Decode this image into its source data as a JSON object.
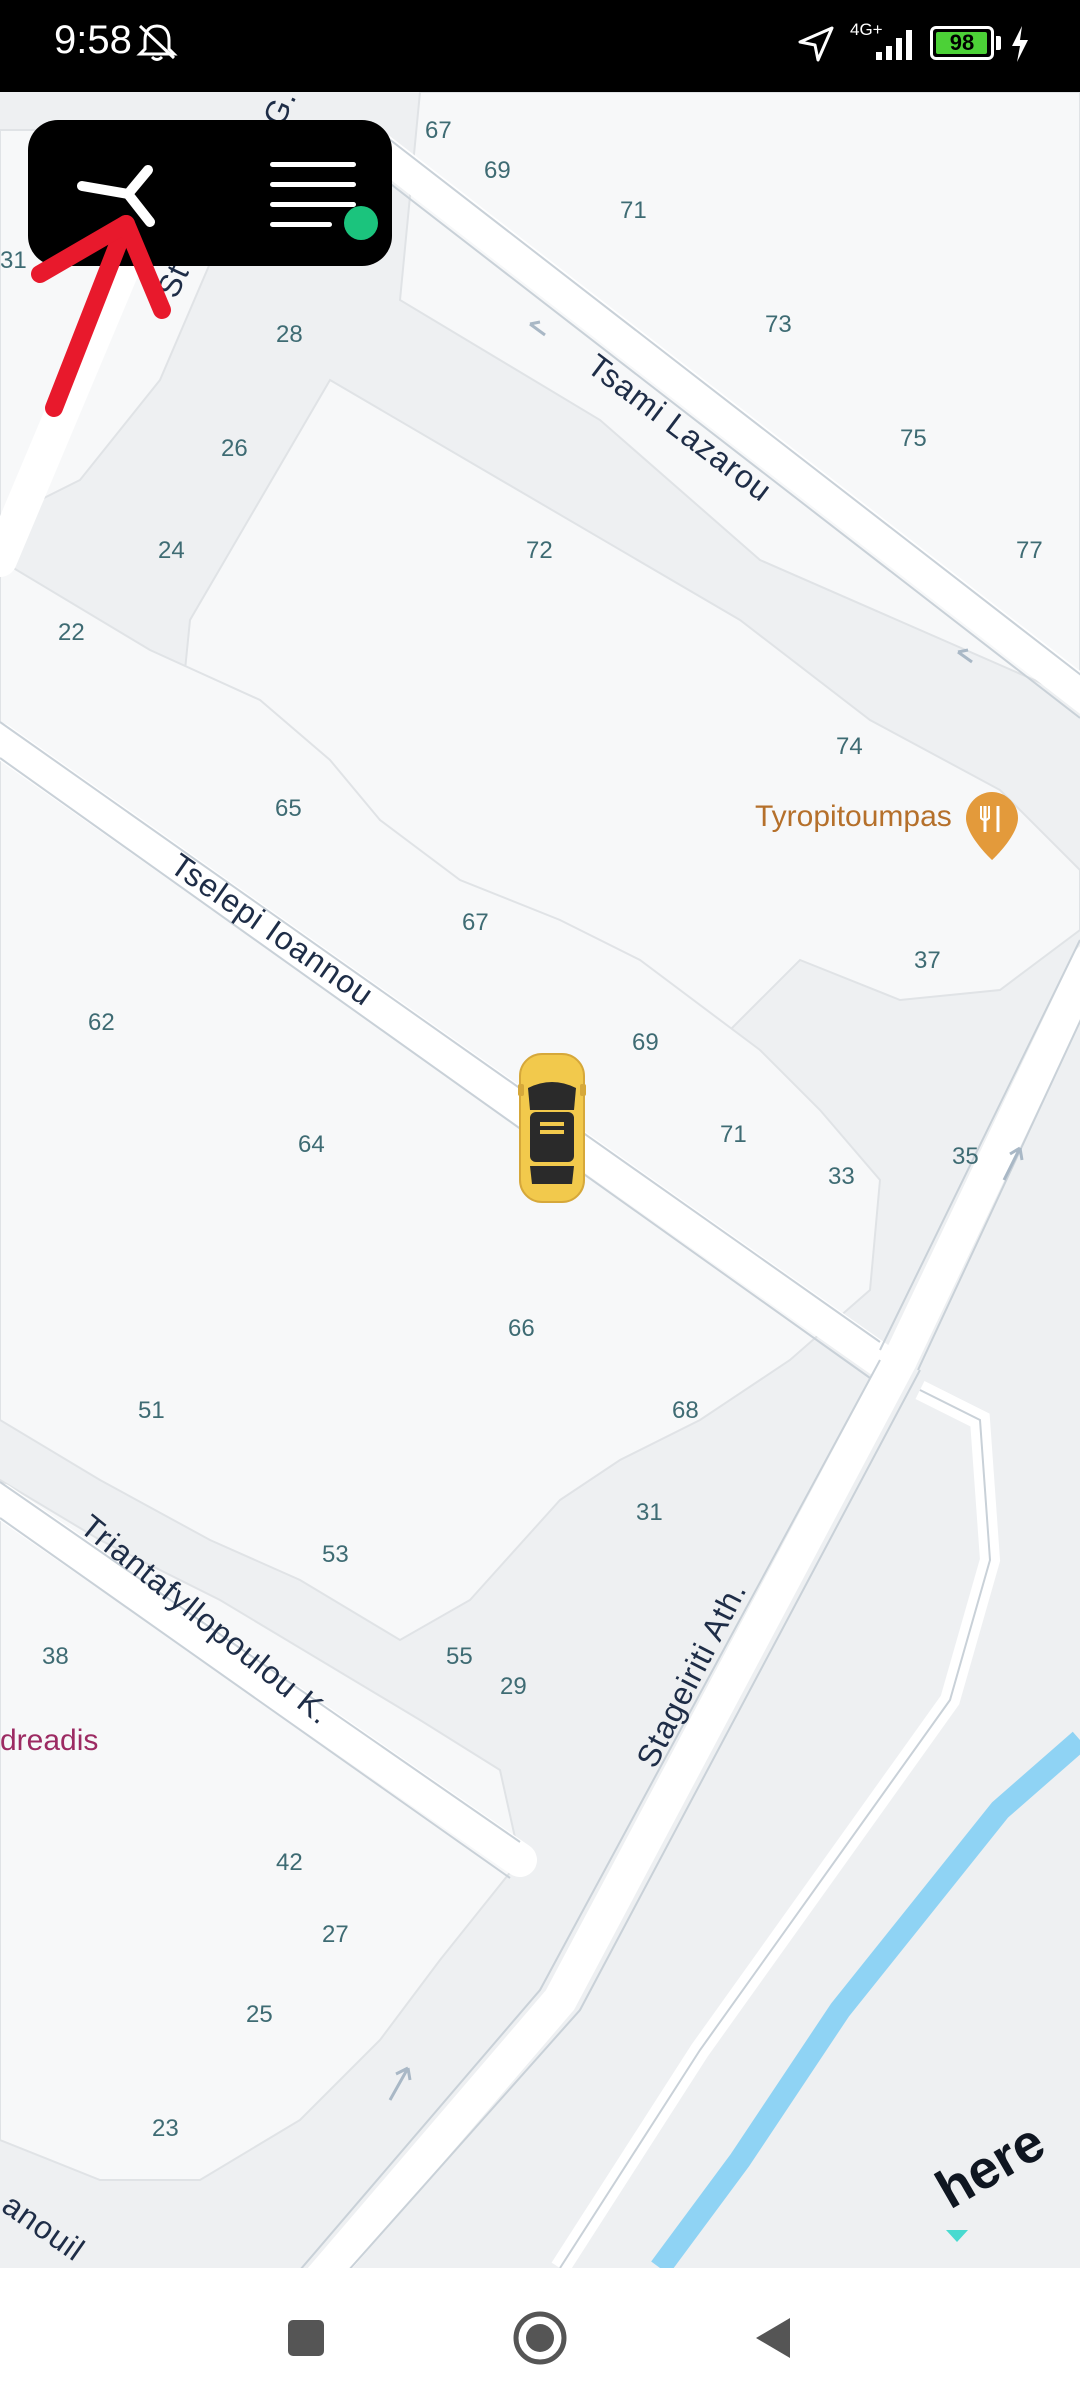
{
  "status_bar": {
    "time": "9:58",
    "network": "4G+",
    "battery": "98",
    "battery_level": 0.98,
    "icons": [
      "bell-off-icon",
      "location-arrow-icon",
      "signal-icon",
      "battery-icon",
      "charging-icon"
    ]
  },
  "map": {
    "streets": [
      "Tsami Lazarou",
      "Tselepi Ioannou",
      "Triantafyllopoulou K.",
      "Stageiriti Ath.",
      "St",
      "G.",
      "anouil"
    ],
    "poi": {
      "name": "Tyropitoumpas",
      "partial": "dreadis"
    },
    "house_numbers": [
      "67",
      "69",
      "71",
      "73",
      "75",
      "77",
      "28",
      "26",
      "24",
      "22",
      "72",
      "74",
      "65",
      "67",
      "37",
      "62",
      "64",
      "69",
      "71",
      "33",
      "35",
      "66",
      "68",
      "51",
      "53",
      "31",
      "55",
      "29",
      "38",
      "42",
      "27",
      "25",
      "23",
      "31"
    ],
    "attribution": "here",
    "colors": {
      "map_bg": "#eef0f2",
      "block": "#f7f8f9",
      "road": "#ffffff",
      "river": "#8fd3f4",
      "poi": "#e39a3b",
      "vehicle": "#f2c94c"
    }
  },
  "top_panel": {
    "icons": [
      "app-logo-icon",
      "menu-icon"
    ],
    "online_status": "online"
  },
  "annotation": {
    "icons": [
      "red-arrow-icon"
    ]
  },
  "nav_bar": {
    "icons": [
      "recents-icon",
      "home-icon",
      "back-icon"
    ]
  }
}
